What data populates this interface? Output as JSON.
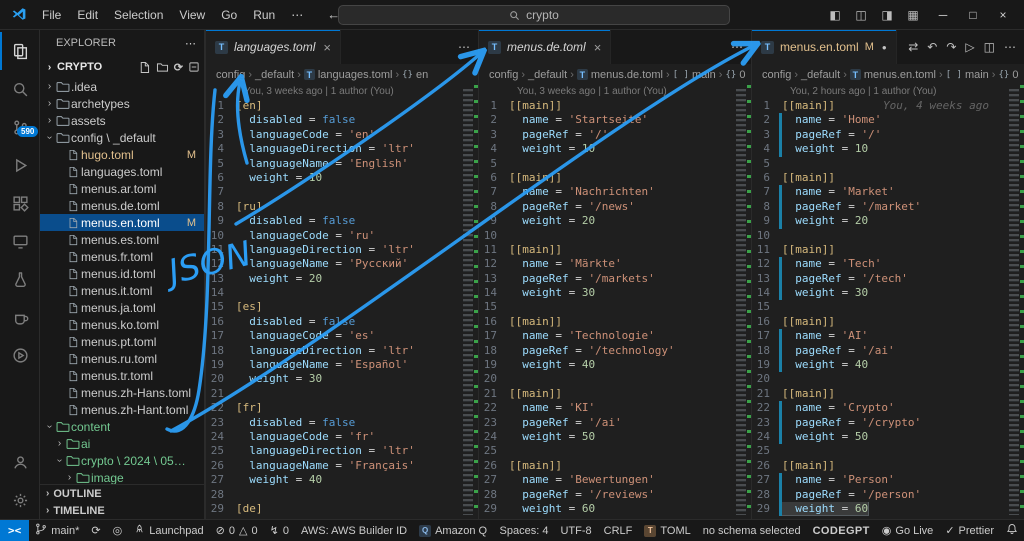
{
  "window": {
    "search_value": "crypto"
  },
  "title_bar": {
    "menus": [
      "File",
      "Edit",
      "Selection",
      "View",
      "Go",
      "Run",
      "⋯"
    ],
    "layout_icons": [
      "toggle-primary-sidebar-icon",
      "toggle-panel-icon",
      "toggle-secondary-sidebar-icon",
      "customize-layout-icon"
    ],
    "window_controls": [
      "minimize-icon",
      "maximize-icon",
      "close-icon"
    ]
  },
  "activity_bar": {
    "items": [
      {
        "name": "explorer",
        "active": true
      },
      {
        "name": "search"
      },
      {
        "name": "source-control",
        "badge": "590"
      },
      {
        "name": "run-debug"
      },
      {
        "name": "extensions"
      },
      {
        "name": "remote-explorer"
      },
      {
        "name": "testing"
      },
      {
        "name": "amazon-q"
      },
      {
        "name": "codegpt"
      }
    ],
    "bottom": [
      {
        "name": "account"
      },
      {
        "name": "settings"
      }
    ]
  },
  "sidebar": {
    "title": "EXPLORER",
    "more": "⋯",
    "root": "CRYPTO",
    "tree": [
      {
        "label": ".idea",
        "depth": 1,
        "kind": "folder",
        "state": "collapsed"
      },
      {
        "label": "archetypes",
        "depth": 1,
        "kind": "folder",
        "state": "collapsed"
      },
      {
        "label": "assets",
        "depth": 1,
        "kind": "folder",
        "state": "collapsed"
      },
      {
        "label": "config \\ _default",
        "depth": 1,
        "kind": "folder",
        "state": "expanded"
      },
      {
        "label": "hugo.toml",
        "depth": 2,
        "kind": "file",
        "git": "modified",
        "badge": "M"
      },
      {
        "label": "languages.toml",
        "depth": 2,
        "kind": "file"
      },
      {
        "label": "menus.ar.toml",
        "depth": 2,
        "kind": "file"
      },
      {
        "label": "menus.de.toml",
        "depth": 2,
        "kind": "file"
      },
      {
        "label": "menus.en.toml",
        "depth": 2,
        "kind": "file",
        "git": "modified",
        "badge": "M",
        "selected": true
      },
      {
        "label": "menus.es.toml",
        "depth": 2,
        "kind": "file"
      },
      {
        "label": "menus.fr.toml",
        "depth": 2,
        "kind": "file"
      },
      {
        "label": "menus.id.toml",
        "depth": 2,
        "kind": "file"
      },
      {
        "label": "menus.it.toml",
        "depth": 2,
        "kind": "file"
      },
      {
        "label": "menus.ja.toml",
        "depth": 2,
        "kind": "file"
      },
      {
        "label": "menus.ko.toml",
        "depth": 2,
        "kind": "file"
      },
      {
        "label": "menus.pt.toml",
        "depth": 2,
        "kind": "file"
      },
      {
        "label": "menus.ru.toml",
        "depth": 2,
        "kind": "file"
      },
      {
        "label": "menus.tr.toml",
        "depth": 2,
        "kind": "file"
      },
      {
        "label": "menus.zh-Hans.toml",
        "depth": 2,
        "kind": "file"
      },
      {
        "label": "menus.zh-Hant.toml",
        "depth": 2,
        "kind": "file"
      },
      {
        "label": "content",
        "depth": 1,
        "kind": "folder",
        "state": "expanded",
        "git": "untracked"
      },
      {
        "label": "ai",
        "depth": 2,
        "kind": "folder",
        "state": "collapsed",
        "git": "untracked"
      },
      {
        "label": "crypto \\ 2024 \\ 05…",
        "depth": 2,
        "kind": "folder",
        "state": "expanded",
        "git": "untracked"
      },
      {
        "label": "image",
        "depth": 3,
        "kind": "folder",
        "state": "collapsed",
        "git": "untracked"
      }
    ],
    "sections": [
      "OUTLINE",
      "TIMELINE"
    ]
  },
  "groups": [
    {
      "tab": {
        "label": "languages.toml",
        "preview": true,
        "close": "×"
      },
      "actions": [
        "more"
      ],
      "breadcrumb": [
        {
          "label": "config"
        },
        {
          "label": "_default"
        },
        {
          "label": "languages.toml",
          "icon": "toml"
        },
        {
          "label": "en",
          "icon": "object"
        }
      ],
      "lens": "You, 3 weeks ago | 1 author (You)",
      "lines": [
        "[en]",
        "  disabled = false",
        "  languageCode = 'en'",
        "  languageDirection = 'ltr'",
        "  languageName = 'English'",
        "  weight = 10",
        "",
        "[ru]",
        "  disabled = false",
        "  languageCode = 'ru'",
        "  languageDirection = 'ltr'",
        "  languageName = 'Русский'",
        "  weight = 20",
        "",
        "[es]",
        "  disabled = false",
        "  languageCode = 'es'",
        "  languageDirection = 'ltr'",
        "  languageName = 'Español'",
        "  weight = 30",
        "",
        "[fr]",
        "  disabled = false",
        "  languageCode = 'fr'",
        "  languageDirection = 'ltr'",
        "  languageName = 'Français'",
        "  weight = 40",
        "",
        "[de]"
      ]
    },
    {
      "tab": {
        "label": "menus.de.toml",
        "preview": true,
        "close": "×"
      },
      "actions": [
        "more"
      ],
      "breadcrumb": [
        {
          "label": "config"
        },
        {
          "label": "_default"
        },
        {
          "label": "menus.de.toml",
          "icon": "toml"
        },
        {
          "label": "main",
          "icon": "array"
        },
        {
          "label": "0",
          "icon": "object"
        }
      ],
      "lens": "You, 3 weeks ago | 1 author (You)",
      "lines": [
        "[[main]]",
        "  name = 'Startseite'",
        "  pageRef = '/'",
        "  weight = 10",
        "",
        "[[main]]",
        "  name = 'Nachrichten'",
        "  pageRef = '/news'",
        "  weight = 20",
        "",
        "[[main]]",
        "  name = 'Märkte'",
        "  pageRef = '/markets'",
        "  weight = 30",
        "",
        "[[main]]",
        "  name = 'Technologie'",
        "  pageRef = '/technology'",
        "  weight = 40",
        "",
        "[[main]]",
        "  name = 'KI'",
        "  pageRef = '/ai'",
        "  weight = 50",
        "",
        "[[main]]",
        "  name = 'Bewertungen'",
        "  pageRef = '/reviews'",
        "  weight = 60"
      ]
    },
    {
      "tab": {
        "label": "menus.en.toml",
        "modified": true,
        "badge": "M"
      },
      "actions": [
        "open-changes",
        "undo",
        "redo",
        "run",
        "split-editor",
        "more"
      ],
      "breadcrumb": [
        {
          "label": "config"
        },
        {
          "label": "_default"
        },
        {
          "label": "menus.en.toml",
          "icon": "toml"
        },
        {
          "label": "main",
          "icon": "array"
        },
        {
          "label": "0",
          "icon": "object"
        }
      ],
      "lens": "You, 2 hours ago | 1 author (You)",
      "inline_blame": "You, 4 weeks ago",
      "highlight_line": 29,
      "changed_lines": [
        2,
        3,
        4,
        7,
        8,
        9,
        12,
        13,
        14,
        17,
        18,
        19,
        22,
        23,
        24,
        27,
        28,
        29
      ],
      "lines": [
        "[[main]]",
        "  name = 'Home'",
        "  pageRef = '/'",
        "  weight = 10",
        "",
        "[[main]]",
        "  name = 'Market'",
        "  pageRef = '/market'",
        "  weight = 20",
        "",
        "[[main]]",
        "  name = 'Tech'",
        "  pageRef = '/tech'",
        "  weight = 30",
        "",
        "[[main]]",
        "  name = 'AI'",
        "  pageRef = '/ai'",
        "  weight = 40",
        "",
        "[[main]]",
        "  name = 'Crypto'",
        "  pageRef = '/crypto'",
        "  weight = 50",
        "",
        "[[main]]",
        "  name = 'Person'",
        "  pageRef = '/person'",
        "  weight = 60"
      ]
    }
  ],
  "status_bar": {
    "left": [
      {
        "name": "remote-indicator",
        "icon": "remote",
        "label": "",
        "style": "remote"
      },
      {
        "name": "branch-indicator",
        "icon": "branch",
        "label": "main*"
      },
      {
        "name": "sync-indicator",
        "icon": "sync",
        "label": ""
      },
      {
        "name": "target-indicator",
        "icon": "target",
        "label": ""
      },
      {
        "name": "gitlens-launchpad",
        "icon": "rocket",
        "label": "Launchpad"
      },
      {
        "name": "problems-indicator",
        "error_count": "0",
        "warning_count": "0"
      },
      {
        "name": "counter-indicator",
        "icon": "bolt",
        "label": "0"
      },
      {
        "name": "aws-builder-id",
        "label": "AWS: AWS Builder ID"
      },
      {
        "name": "amazon-q",
        "icon": "q-chip",
        "label": "Amazon Q"
      }
    ],
    "right": [
      {
        "name": "indentation",
        "label": "Spaces: 4"
      },
      {
        "name": "encoding",
        "label": "UTF-8"
      },
      {
        "name": "eol",
        "label": "CRLF"
      },
      {
        "name": "language-mode",
        "icon": "toml-chip",
        "label": "TOML"
      },
      {
        "name": "schema",
        "label": "no schema selected"
      },
      {
        "name": "codegpt",
        "label": "CODEGPT"
      },
      {
        "name": "go-live",
        "icon": "broadcast",
        "label": "Go Live"
      },
      {
        "name": "prettier",
        "icon": "check",
        "label": "Prettier"
      },
      {
        "name": "notifications",
        "icon": "bell",
        "label": ""
      }
    ]
  },
  "annotations": {
    "label": "JSON",
    "color": "#2b9df4"
  }
}
